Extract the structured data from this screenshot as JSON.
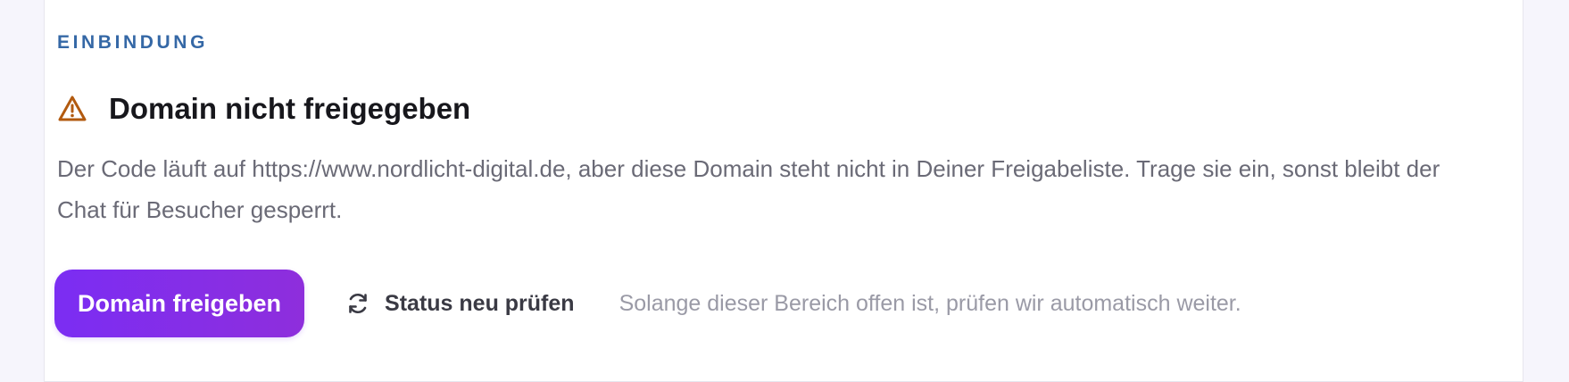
{
  "section": {
    "label": "EINBINDUNG"
  },
  "alert": {
    "icon": "warning-triangle-icon",
    "title": "Domain nicht freigegeben",
    "description": "Der Code läuft auf https://www.nordlicht-digital.de, aber diese Domain steht nicht in Deiner Freigabeliste. Trage sie ein, sonst bleibt der Chat für Besucher gesperrt."
  },
  "actions": {
    "primary_label": "Domain freigeben",
    "secondary_label": "Status neu prüfen",
    "secondary_icon": "refresh-icon",
    "hint": "Solange dieser Bereich offen ist, prüfen wir automatisch weiter."
  },
  "colors": {
    "accent_label": "#3568a6",
    "warning": "#b25a0f",
    "primary_gradient_start": "#7b2df3",
    "primary_gradient_end": "#8e2edc"
  }
}
